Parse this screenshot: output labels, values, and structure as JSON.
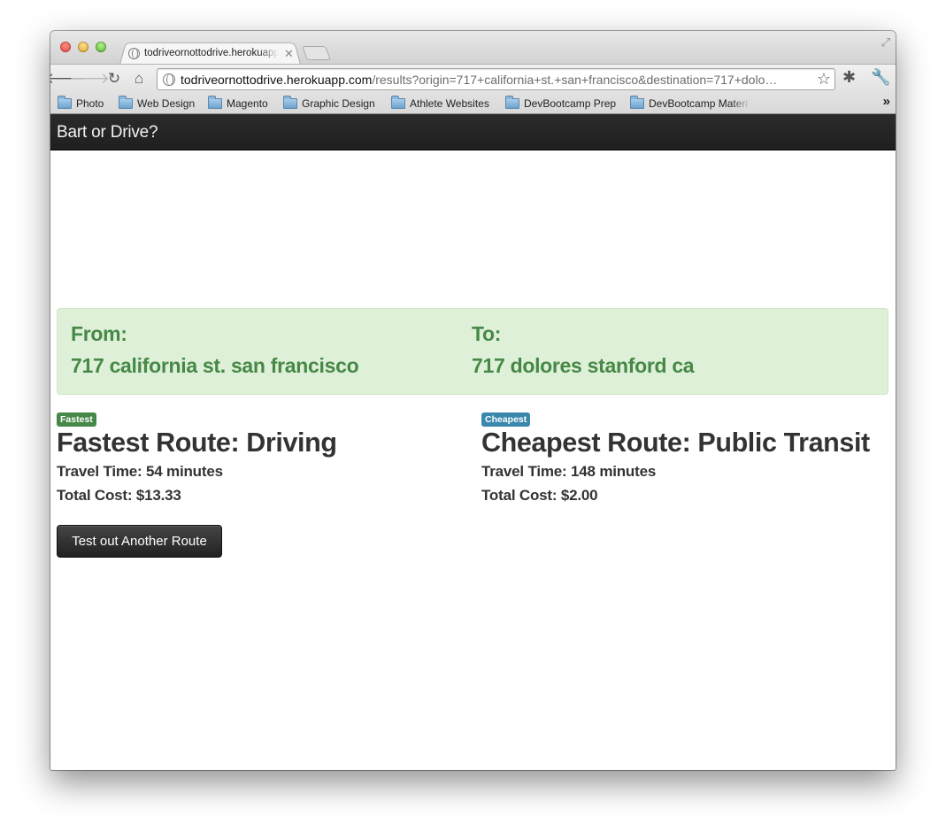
{
  "browser": {
    "tab_title": "todriveornottodrive.herokuapp.com",
    "tab_close": "✕",
    "url_host": "todriveornottodrive.herokuapp.com",
    "url_path": "/results?origin=717+california+st.+san+francisco&destination=717+dolo…",
    "bookmarks": [
      "Photo",
      "Web Design",
      "Magento",
      "Graphic Design",
      "Athlete Websites",
      "DevBootcamp Prep",
      "DevBootcamp Materi"
    ],
    "bookmarks_overflow": "»"
  },
  "navbar": {
    "brand": "Bart or Drive?"
  },
  "trip": {
    "from_label": "From:",
    "from_value": "717 california st. san francisco",
    "to_label": "To:",
    "to_value": "717 dolores stanford ca"
  },
  "fastest": {
    "badge": "Fastest",
    "badge_color": "#468847",
    "title": "Fastest Route: Driving",
    "travel_time": "Travel Time: 54 minutes",
    "total_cost": "Total Cost: $13.33"
  },
  "cheapest": {
    "badge": "Cheapest",
    "badge_color": "#3a87ad",
    "title": "Cheapest Route: Public Transit",
    "travel_time": "Travel Time: 148 minutes",
    "total_cost": "Total Cost: $2.00"
  },
  "actions": {
    "another_route": "Test out Another Route"
  },
  "colors": {
    "alert_bg": "#dff0d8",
    "alert_text": "#468847",
    "navbar_bg": "#222222"
  }
}
